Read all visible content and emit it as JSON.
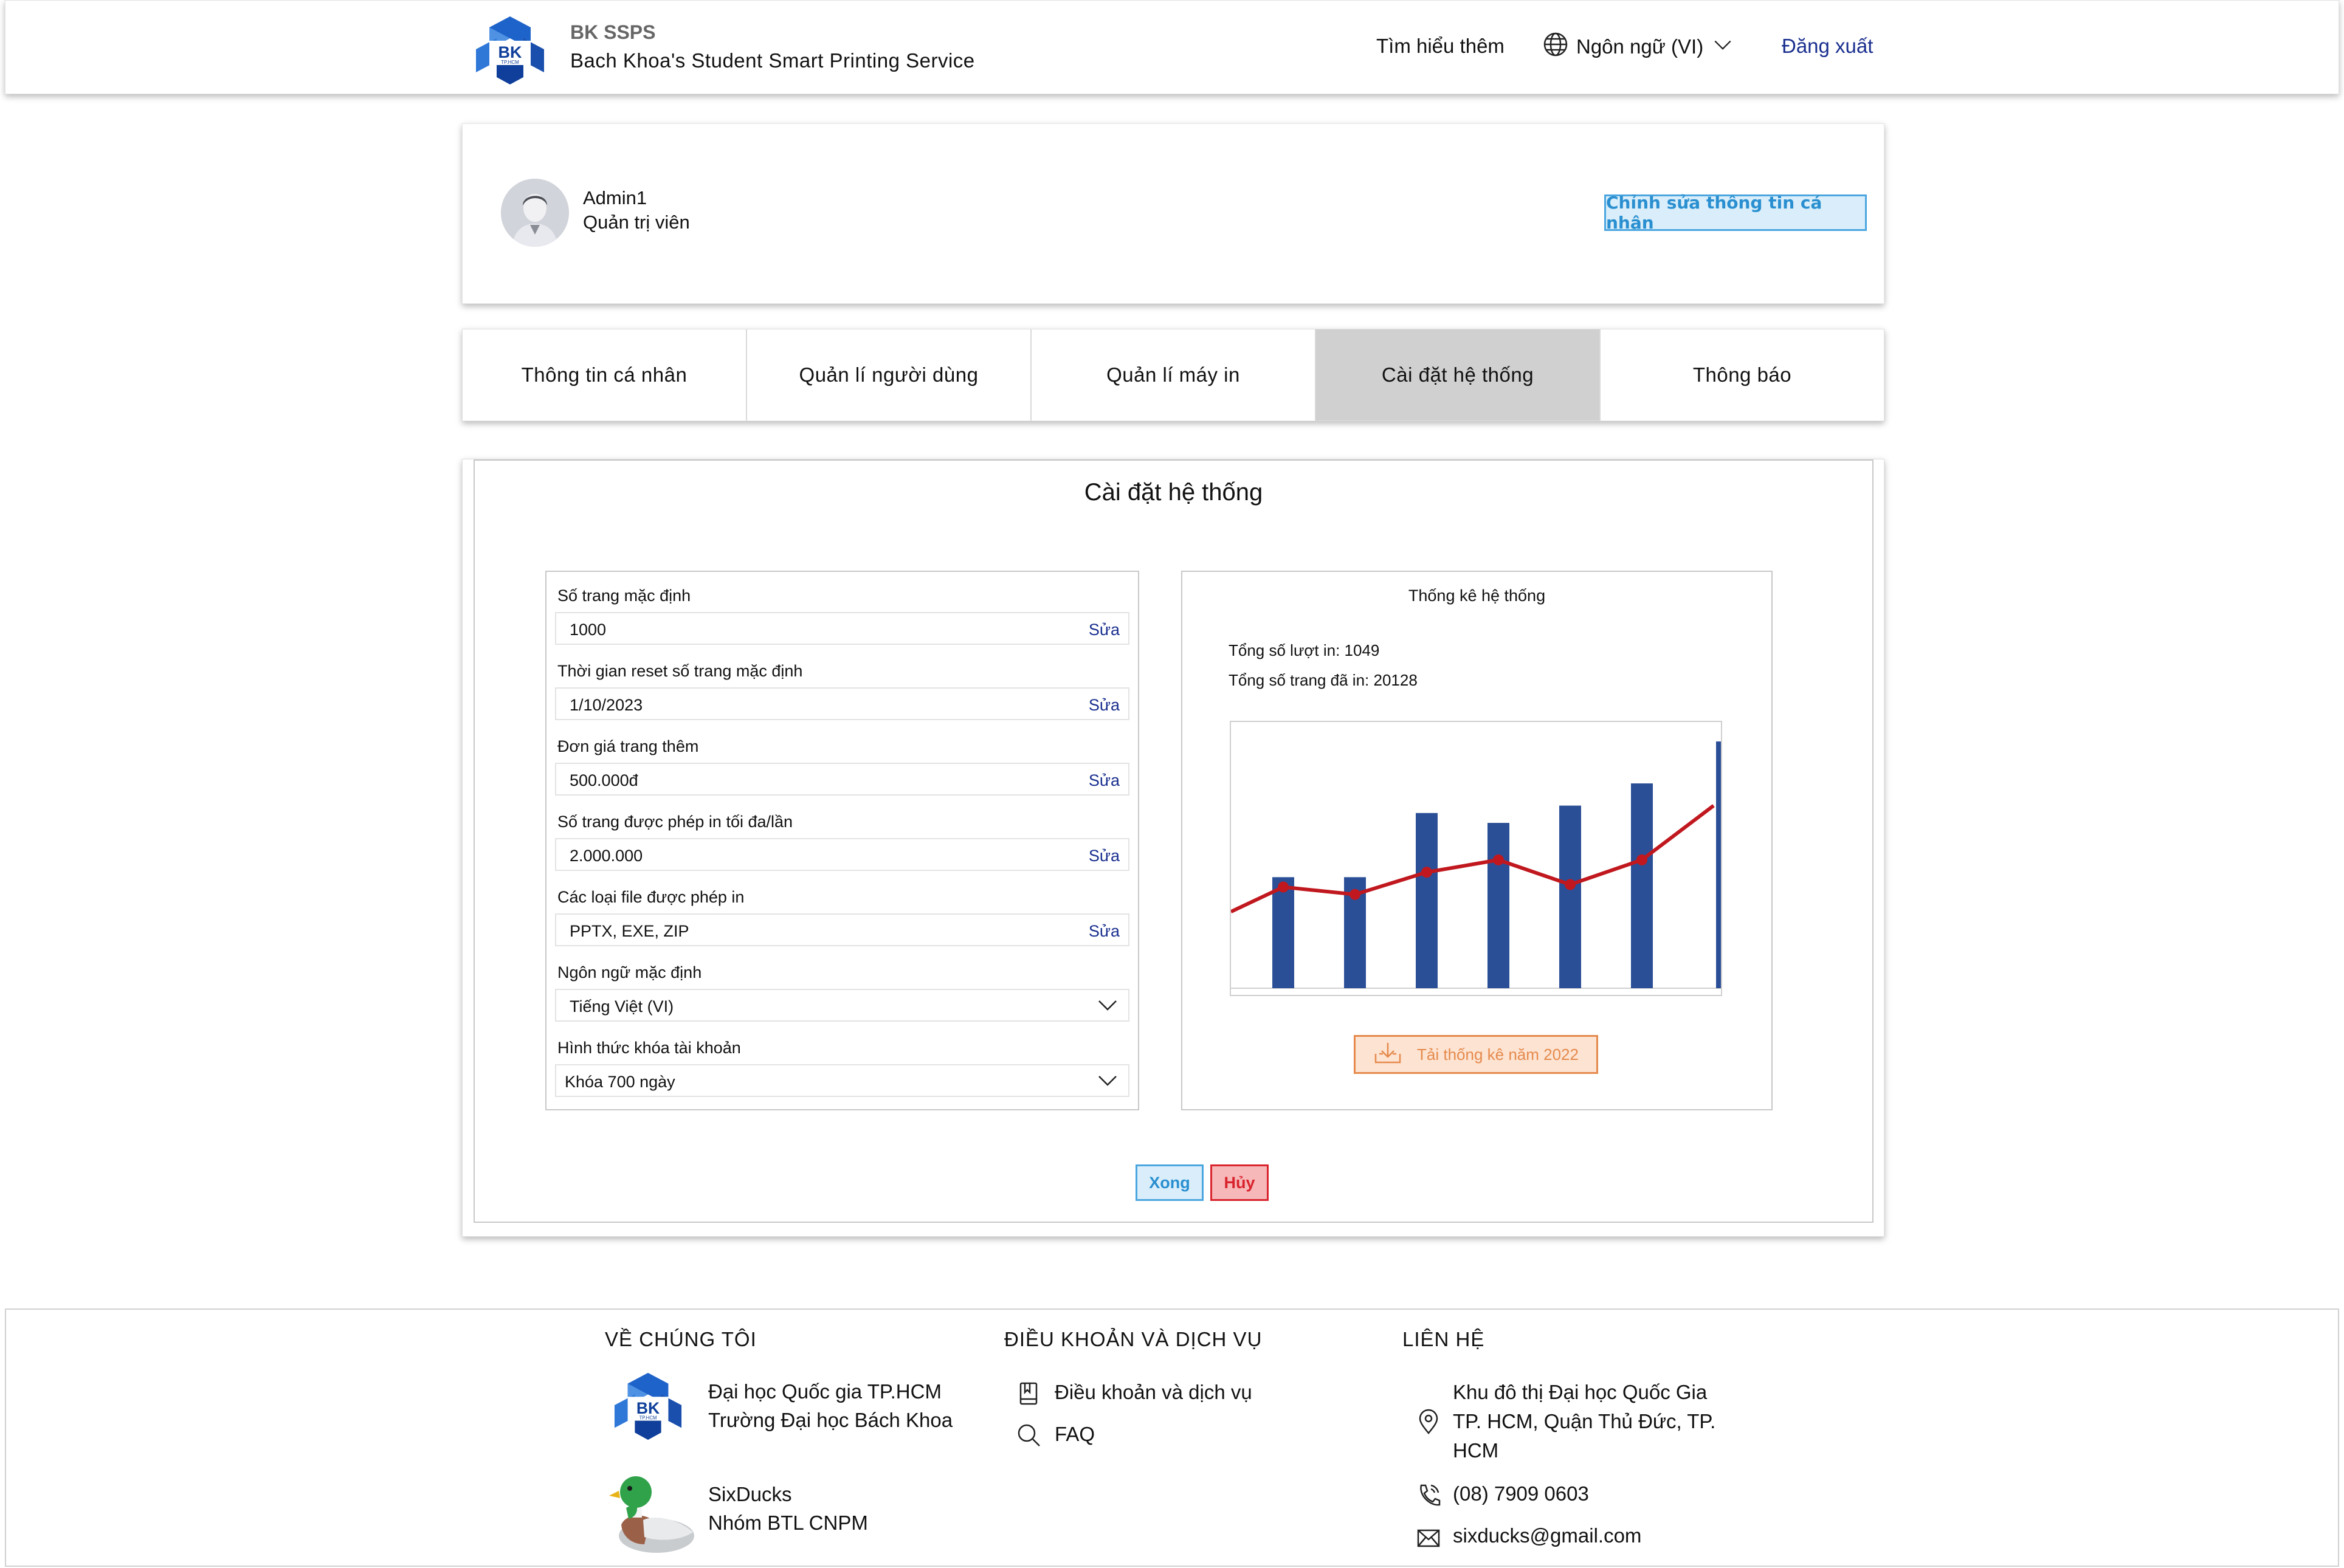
{
  "header": {
    "brand_name": "BK SSPS",
    "brand_subtitle": "Bach Khoa's Student Smart Printing Service",
    "learn_more": "Tìm hiểu thêm",
    "language": "Ngôn ngữ (VI)",
    "logout": "Đăng xuất",
    "logo_text": "BK",
    "logo_subtext": "TP.HCM"
  },
  "profile": {
    "name": "Admin1",
    "role": "Quản trị viên",
    "edit_button": "Chỉnh sửa thông tin cá nhân"
  },
  "tabs": [
    {
      "label": "Thông tin cá nhân",
      "active": false
    },
    {
      "label": "Quản lí người dùng",
      "active": false
    },
    {
      "label": "Quản lí máy in",
      "active": false
    },
    {
      "label": "Cài đặt hệ thống",
      "active": true
    },
    {
      "label": "Thông báo",
      "active": false
    }
  ],
  "settings": {
    "title": "Cài đặt hệ thống",
    "edit_label": "Sửa",
    "fields": [
      {
        "label": "Số trang mặc định",
        "value": "1000"
      },
      {
        "label": "Thời gian reset số trang mặc định",
        "value": "1/10/2023"
      },
      {
        "label": "Đơn giá trang thêm",
        "value": "500.000đ"
      },
      {
        "label": "Số trang được phép in tối đa/lần",
        "value": "2.000.000"
      },
      {
        "label": "Các loại file được phép in",
        "value": "PPTX, EXE, ZIP"
      }
    ],
    "selects": [
      {
        "label": "Ngôn ngữ mặc định",
        "value": "Tiếng Việt (VI)"
      },
      {
        "label": "Hình thức khóa tài khoản",
        "value": "Khóa 700 ngày"
      }
    ],
    "done_button": "Xong",
    "cancel_button": "Hủy"
  },
  "stats": {
    "title": "Thống kê hệ thống",
    "total_prints": "Tổng số lượt in: 1049",
    "total_pages": "Tổng số trang đã in: 20128",
    "download_button": "Tải thống kê năm 2022"
  },
  "chart_data": {
    "type": "bar",
    "title": "",
    "xlabel": "",
    "ylabel": "",
    "ylim": [
      0,
      100
    ],
    "grid": false,
    "bar_color": "#2b4f96",
    "line_color": "#c0181e",
    "bars": [
      45,
      45,
      71,
      67,
      74,
      83,
      100
    ],
    "line_x": [
      0,
      0.5,
      1.5,
      2.5,
      3.5,
      4.5,
      5.5,
      6.5
    ],
    "line": [
      31,
      41,
      38,
      47,
      52,
      42,
      52,
      74
    ]
  },
  "footer": {
    "about_heading": "VỀ CHÚNG TÔI",
    "about_line1": "Đại học Quốc gia TP.HCM",
    "about_line2": "Trường Đại học Bách Khoa",
    "team_line1": "SixDucks",
    "team_line2": "Nhóm BTL CNPM",
    "terms_heading": "ĐIỀU KHOẢN VÀ DỊCH VỤ",
    "terms_link": "Điều khoản và dịch vụ",
    "faq_link": "FAQ",
    "contact_heading": "LIÊN HỆ",
    "address_line1": "Khu đô thị Đại học Quốc Gia",
    "address_line2": "TP. HCM, Quận Thủ Đức, TP.",
    "address_line3": "HCM",
    "phone": "(08) 7909 0603",
    "email": "sixducks@gmail.com"
  }
}
